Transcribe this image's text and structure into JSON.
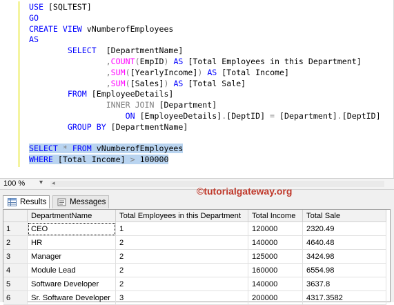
{
  "editor": {
    "lines": [
      [
        {
          "t": "USE ",
          "c": "kw"
        },
        {
          "t": "[SQLTEST]",
          "c": ""
        }
      ],
      [
        {
          "t": "GO",
          "c": "kw"
        }
      ],
      [
        {
          "t": "CREATE VIEW ",
          "c": "kw"
        },
        {
          "t": "vNumberofEmployees",
          "c": ""
        }
      ],
      [
        {
          "t": "AS",
          "c": "kw"
        }
      ],
      [
        {
          "t": "        SELECT  ",
          "c": "kw"
        },
        {
          "t": "[DepartmentName]",
          "c": ""
        }
      ],
      [
        {
          "t": "                ",
          "c": ""
        },
        {
          "t": ",",
          "c": "op"
        },
        {
          "t": "COUNT",
          "c": "fn"
        },
        {
          "t": "(",
          "c": "op"
        },
        {
          "t": "EmpID",
          "c": ""
        },
        {
          "t": ") ",
          "c": "op"
        },
        {
          "t": "AS ",
          "c": "kw"
        },
        {
          "t": "[Total Employees in this Department]",
          "c": ""
        }
      ],
      [
        {
          "t": "                ",
          "c": ""
        },
        {
          "t": ",",
          "c": "op"
        },
        {
          "t": "SUM",
          "c": "fn"
        },
        {
          "t": "(",
          "c": "op"
        },
        {
          "t": "[YearlyIncome]",
          "c": ""
        },
        {
          "t": ") ",
          "c": "op"
        },
        {
          "t": "AS ",
          "c": "kw"
        },
        {
          "t": "[Total Income]",
          "c": ""
        }
      ],
      [
        {
          "t": "                ",
          "c": ""
        },
        {
          "t": ",",
          "c": "op"
        },
        {
          "t": "SUM",
          "c": "fn"
        },
        {
          "t": "(",
          "c": "op"
        },
        {
          "t": "[Sales]",
          "c": ""
        },
        {
          "t": ") ",
          "c": "op"
        },
        {
          "t": "AS ",
          "c": "kw"
        },
        {
          "t": "[Total Sale]",
          "c": ""
        }
      ],
      [
        {
          "t": "        FROM ",
          "c": "kw"
        },
        {
          "t": "[EmployeeDetails]",
          "c": ""
        }
      ],
      [
        {
          "t": "                ",
          "c": ""
        },
        {
          "t": "INNER JOIN ",
          "c": "op"
        },
        {
          "t": "[Department]",
          "c": ""
        }
      ],
      [
        {
          "t": "                    ",
          "c": ""
        },
        {
          "t": "ON ",
          "c": "kw"
        },
        {
          "t": "[EmployeeDetails]",
          "c": ""
        },
        {
          "t": ".",
          "c": "op"
        },
        {
          "t": "[DeptID] ",
          "c": ""
        },
        {
          "t": "= ",
          "c": "op"
        },
        {
          "t": "[Department]",
          "c": ""
        },
        {
          "t": ".",
          "c": "op"
        },
        {
          "t": "[DeptID]",
          "c": ""
        }
      ],
      [
        {
          "t": "        GROUP BY ",
          "c": "kw"
        },
        {
          "t": "[DepartmentName]",
          "c": ""
        }
      ],
      [],
      [
        {
          "t": "SELECT ",
          "c": "kw sel"
        },
        {
          "t": "* ",
          "c": "op sel"
        },
        {
          "t": "FROM ",
          "c": "kw sel"
        },
        {
          "t": "vNumberofEmployees",
          "c": "sel"
        }
      ],
      [
        {
          "t": "WHERE ",
          "c": "kw sel"
        },
        {
          "t": "[Total Income] ",
          "c": "sel"
        },
        {
          "t": "> ",
          "c": "op sel"
        },
        {
          "t": "100000",
          "c": "sel"
        }
      ]
    ]
  },
  "status": {
    "zoom": "100 %",
    "watermark": "©tutorialgateway.org"
  },
  "tabs": [
    {
      "label": "Results",
      "icon": "results-grid-icon"
    },
    {
      "label": "Messages",
      "icon": "messages-icon"
    }
  ],
  "grid": {
    "columns": [
      "DepartmentName",
      "Total Employees in this Department",
      "Total Income",
      "Total Sale"
    ],
    "rows": [
      [
        "1",
        "CEO",
        "1",
        "120000",
        "2320.49"
      ],
      [
        "2",
        "HR",
        "2",
        "140000",
        "4640.48"
      ],
      [
        "3",
        "Manager",
        "2",
        "125000",
        "3424.98"
      ],
      [
        "4",
        "Module Lead",
        "2",
        "160000",
        "6554.98"
      ],
      [
        "5",
        "Software Developer",
        "2",
        "140000",
        "3637.8"
      ],
      [
        "6",
        "Sr. Software Developer",
        "3",
        "200000",
        "4317.3582"
      ]
    ]
  }
}
